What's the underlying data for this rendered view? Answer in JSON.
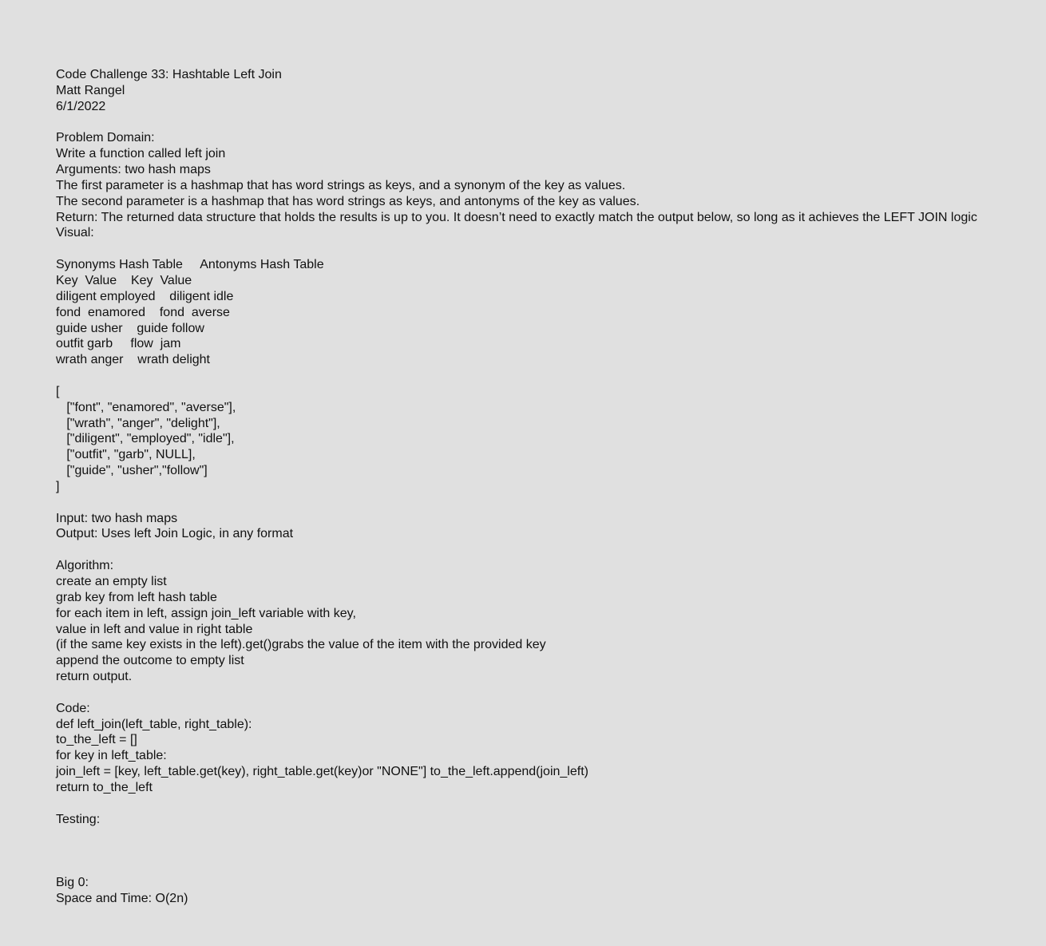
{
  "header": {
    "title": "Code Challenge 33: Hashtable Left Join",
    "author": "Matt Rangel",
    "date": "6/1/2022"
  },
  "problem": {
    "heading": "Problem Domain:",
    "lines": [
      "Write a function called left join",
      "Arguments: two hash maps",
      "The first parameter is a hashmap that has word strings as keys, and a synonym of the key as values.",
      "The second parameter is a hashmap that has word strings as keys, and antonyms of the key as values.",
      "Return: The returned data structure that holds the results is up to you. It doesn’t need to exactly match the output below, so long as it achieves the LEFT JOIN logic",
      "Visual:"
    ]
  },
  "visual": {
    "table_titles": "Synonyms Hash Table     Antonyms Hash Table",
    "header_row": "Key  Value    Key  Value",
    "rows": [
      "diligent employed    diligent idle",
      "fond  enamored    fond  averse",
      "guide usher    guide follow",
      "outfit garb     flow  jam",
      "wrath anger    wrath delight"
    ]
  },
  "output_example": {
    "open": "[",
    "rows": [
      "   [\"font\", \"enamored\", \"averse\"],",
      "   [\"wrath\", \"anger\", \"delight\"],",
      "   [\"diligent\", \"employed\", \"idle\"],",
      "   [\"outfit\", \"garb\", NULL],",
      "   [\"guide\", \"usher\",\"follow\"]"
    ],
    "close": "]"
  },
  "io": {
    "input": "Input: two hash maps",
    "output": "Output: Uses left Join Logic, in any format"
  },
  "algorithm": {
    "heading": "Algorithm:",
    "lines": [
      "create an empty list",
      "grab key from left hash table",
      "for each item in left, assign join_left variable with key,",
      "value in left and value in right table",
      "(if the same key exists in the left).get()grabs the value of the item with the provided key",
      "append the outcome to empty list",
      "return output."
    ]
  },
  "code": {
    "heading": "Code:",
    "lines": [
      "def left_join(left_table, right_table):",
      "to_the_left = []",
      "for key in left_table:",
      "join_left = [key, left_table.get(key), right_table.get(key)or \"NONE\"] to_the_left.append(join_left)",
      "return to_the_left"
    ]
  },
  "testing": {
    "heading": "Testing:"
  },
  "bigo": {
    "heading": "Big 0:",
    "line": "Space and Time: O(2n)"
  }
}
